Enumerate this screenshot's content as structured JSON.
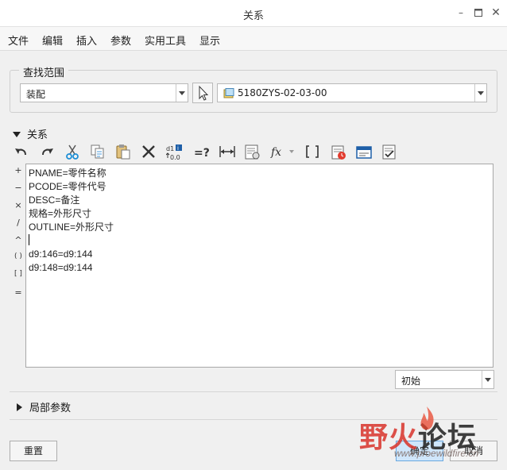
{
  "window": {
    "title": "关系"
  },
  "menu": [
    "文件",
    "编辑",
    "插入",
    "参数",
    "实用工具",
    "显示"
  ],
  "lookin": {
    "group_label": "查找范围",
    "type_value": "装配",
    "model_value": "5180ZYS-02-03-00"
  },
  "relations": {
    "section_label": "关系",
    "toolbar_icons": [
      "undo-icon",
      "redo-icon",
      "cut-icon",
      "copy-icon",
      "paste-icon",
      "delete-icon",
      "show-values-icon",
      "evaluate-icon",
      "dimension-icon",
      "parameters-icon",
      "function-icon",
      "brackets-icon",
      "sort-icon",
      "verify-icon",
      "save-icon"
    ],
    "operators": [
      "+",
      "−",
      "×",
      "/",
      "^",
      "( )",
      "[ ]",
      "="
    ],
    "lines": [
      "PNAME=零件名称",
      "PCODE=零件代号",
      "DESC=备注",
      "规格=外形尺寸",
      "OUTLINE=外形尺寸",
      "",
      "d9:146=d9:144",
      "d9:148=d9:144"
    ],
    "init_value": "初始"
  },
  "local_params": {
    "label": "局部参数"
  },
  "buttons": {
    "reset": "重置",
    "ok": "确定",
    "cancel": "取消"
  },
  "watermark": {
    "text": "野火论坛",
    "url": "www.proewildfire.cn"
  }
}
